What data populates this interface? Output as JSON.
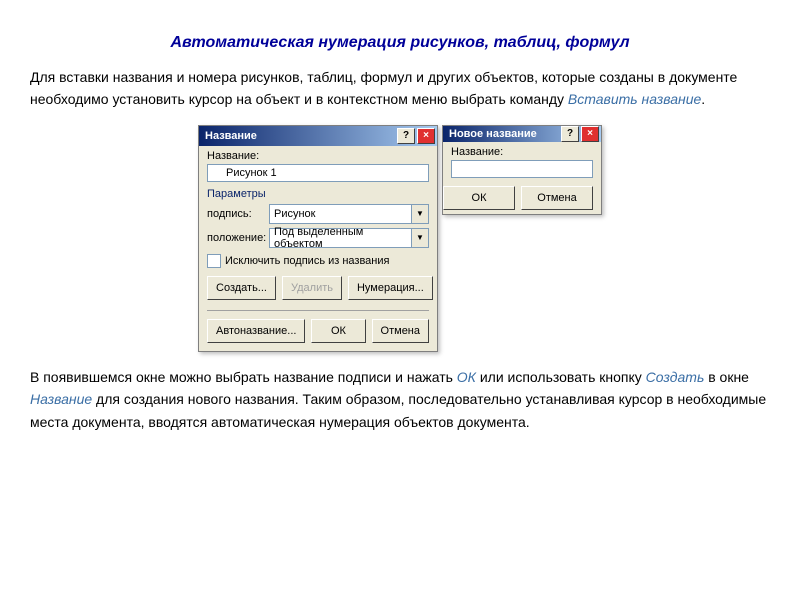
{
  "title": "Автоматическая нумерация рисунков, таблиц, формул",
  "p1": {
    "a": "Для вставки названия и номера рисунков, таблиц, формул и других объектов, которые созданы в документе необходимо установить курсор на объект и в контекстном меню выбрать команду ",
    "b": "Вставить название",
    "c": "."
  },
  "dlg1": {
    "title": "Название",
    "label_name": "Название:",
    "name_value": "Рисунок 1",
    "params": "Параметры",
    "row_caption_label": "подпись:",
    "row_caption_value": "Рисунок",
    "row_position_label": "положение:",
    "row_position_value": "Под выделенным объектом",
    "exclude": "Исключить подпись из названия",
    "btn_create": "Создать...",
    "btn_delete": "Удалить",
    "btn_numbering": "Нумерация...",
    "btn_autoname": "Автоназвание...",
    "btn_ok": "ОК",
    "btn_cancel": "Отмена"
  },
  "dlg2": {
    "title": "Новое название",
    "label": "Название:",
    "btn_ok": "ОК",
    "btn_cancel": "Отмена"
  },
  "p2": {
    "a": "В появившемся окне можно выбрать название подписи и нажать ",
    "b": "ОК",
    "c": " или использовать кнопку ",
    "d": "Создать",
    "e": " в окне ",
    "f": "Название",
    "g": " для создания нового названия. Таким образом, последовательно устанавливая курсор в необходимые места документа, вводятся  автоматическая нумерация объектов документа."
  }
}
